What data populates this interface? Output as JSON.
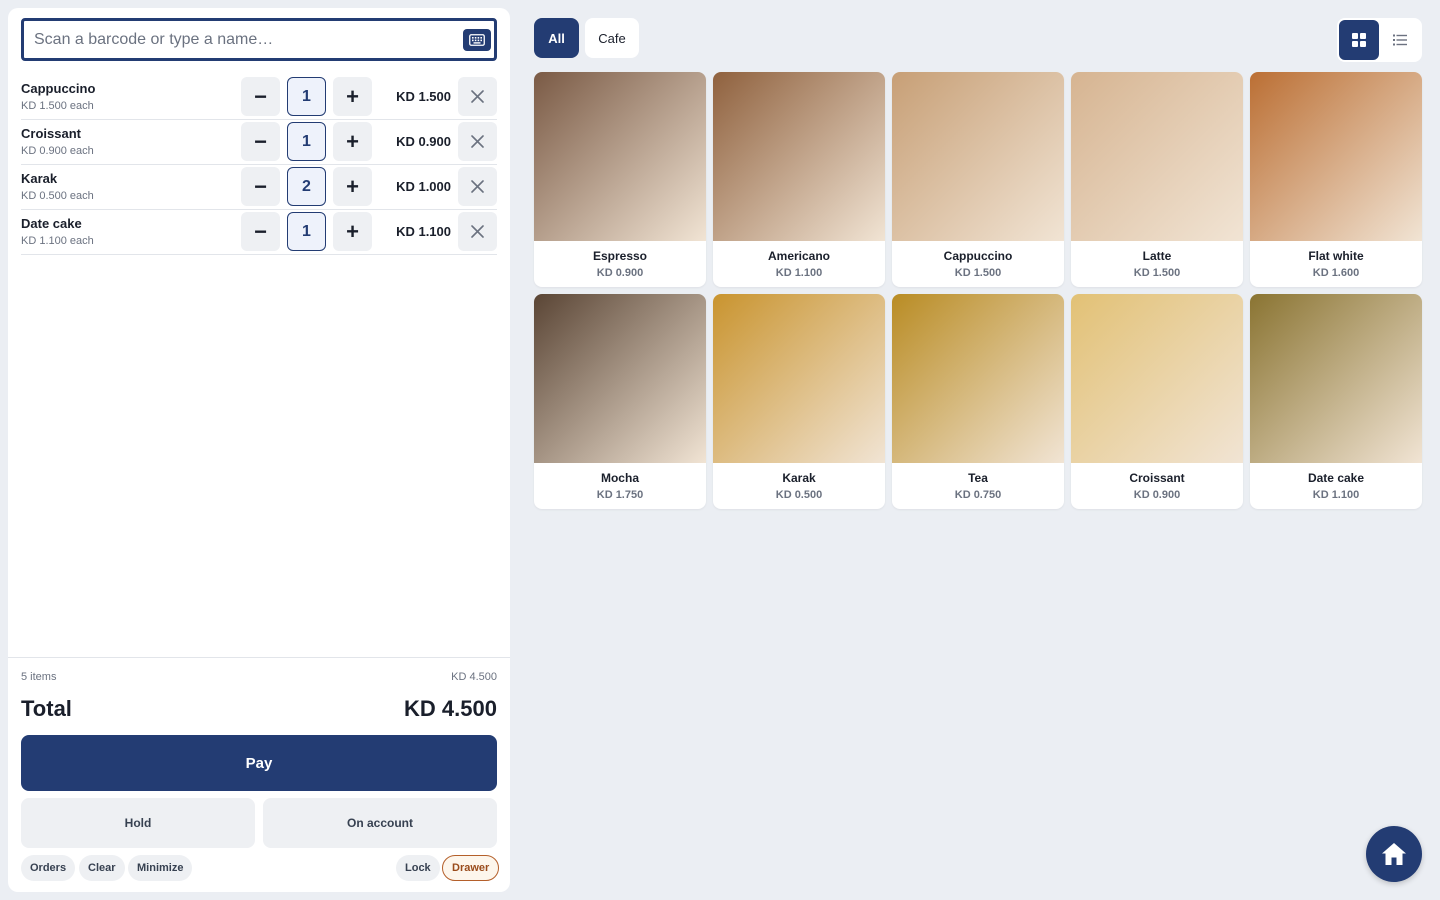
{
  "search": {
    "placeholder": "Scan a barcode or type a name…",
    "value": ""
  },
  "cart": {
    "lines": [
      {
        "name": "Cappuccino",
        "each": "KD 1.500 each",
        "qty": "1",
        "total": "KD 1.500"
      },
      {
        "name": "Croissant",
        "each": "KD 0.900 each",
        "qty": "1",
        "total": "KD 0.900"
      },
      {
        "name": "Karak",
        "each": "KD 0.500 each",
        "qty": "2",
        "total": "KD 1.000"
      },
      {
        "name": "Date cake",
        "each": "KD 1.100 each",
        "qty": "1",
        "total": "KD 1.100"
      }
    ],
    "minus_label": "−",
    "plus_label": "+"
  },
  "summary": {
    "items": "5 items",
    "subtotal": "KD 4.500",
    "total_label": "Total",
    "total_value": "KD 4.500"
  },
  "actions": {
    "pay": "Pay",
    "hold": "Hold",
    "on_account": "On account",
    "orders": "Orders",
    "clear": "Clear",
    "minimize": "Minimize",
    "lock": "Lock",
    "drawer": "Drawer"
  },
  "categories": {
    "all": "All",
    "cafe": "Cafe"
  },
  "products": [
    {
      "name": "Espresso",
      "price": "KD 0.900",
      "color": "#7a5a45"
    },
    {
      "name": "Americano",
      "price": "KD 1.100",
      "color": "#8f613e"
    },
    {
      "name": "Cappuccino",
      "price": "KD 1.500",
      "color": "#c79f76"
    },
    {
      "name": "Latte",
      "price": "KD 1.500",
      "color": "#d6b491"
    },
    {
      "name": "Flat white",
      "price": "KD 1.600",
      "color": "#bb6f34"
    },
    {
      "name": "Mocha",
      "price": "KD 1.750",
      "color": "#5a4535"
    },
    {
      "name": "Karak",
      "price": "KD 0.500",
      "color": "#c9942f"
    },
    {
      "name": "Tea",
      "price": "KD 0.750",
      "color": "#b98c24"
    },
    {
      "name": "Croissant",
      "price": "KD 0.900",
      "color": "#e2c175"
    },
    {
      "name": "Date cake",
      "price": "KD 1.100",
      "color": "#8a7432"
    }
  ],
  "theme": {
    "primary": "#233c73",
    "drawer_accent": "#b45f2a"
  }
}
